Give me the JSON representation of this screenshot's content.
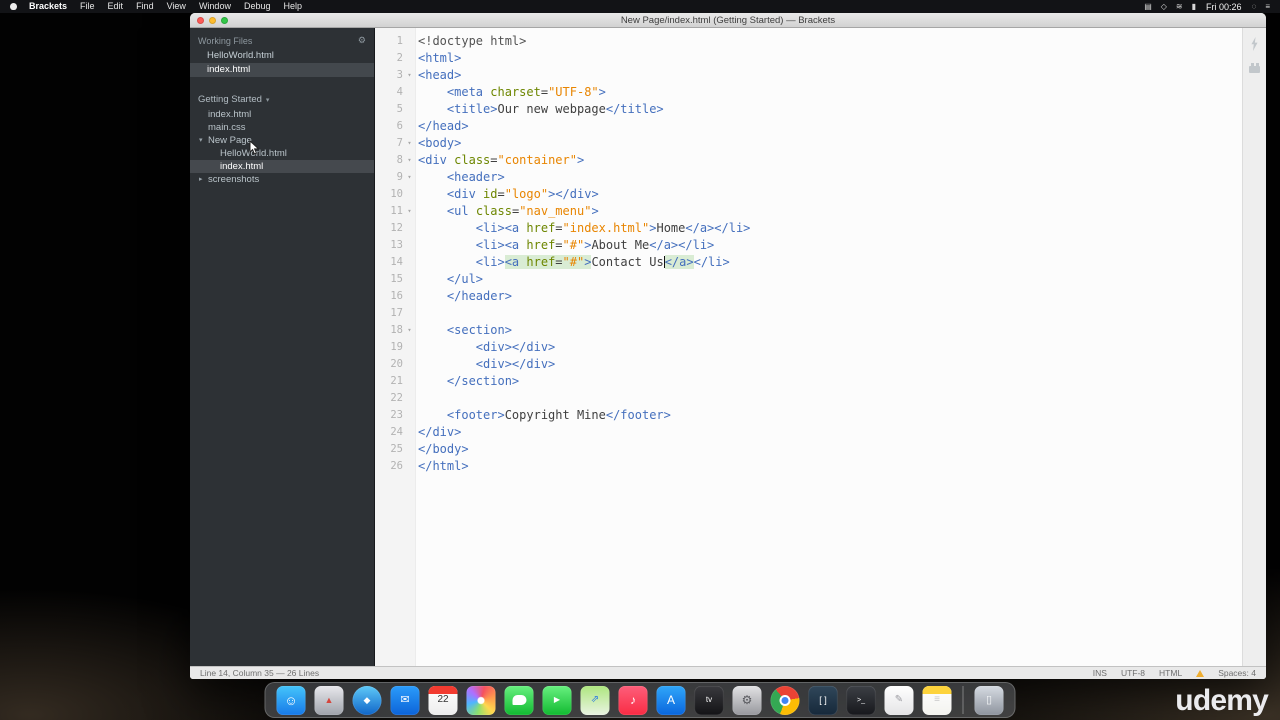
{
  "menu_bar": {
    "items": [
      "Brackets",
      "File",
      "Edit",
      "Find",
      "View",
      "Window",
      "Debug",
      "Help"
    ],
    "status_icons": [
      {
        "name": "display",
        "glyph": "▤"
      },
      {
        "name": "bluetooth",
        "glyph": "◇"
      },
      {
        "name": "wifi",
        "glyph": "≋"
      },
      {
        "name": "battery",
        "glyph": "▮"
      }
    ],
    "clock": "Fri 00:26",
    "after_icons": [
      {
        "name": "spotlight",
        "glyph": "◌"
      },
      {
        "name": "notification-center",
        "glyph": "≡"
      }
    ]
  },
  "window": {
    "title": "New Page/index.html (Getting Started) — Brackets"
  },
  "sidebar": {
    "working_files": {
      "header": "Working Files",
      "files": [
        {
          "name": "HelloWorld.html",
          "active": false
        },
        {
          "name": "index.html",
          "active": true
        }
      ]
    },
    "project": {
      "name": "Getting Started",
      "tree": [
        {
          "name": "index.html",
          "type": "file",
          "depth": 0
        },
        {
          "name": "main.css",
          "type": "file",
          "depth": 0
        },
        {
          "name": "New Page",
          "type": "folder-open",
          "depth": 0
        },
        {
          "name": "HelloWorld.html",
          "type": "file",
          "depth": 1
        },
        {
          "name": "index.html",
          "type": "file",
          "depth": 1,
          "selected": true
        },
        {
          "name": "screenshots",
          "type": "folder",
          "depth": 0
        }
      ]
    }
  },
  "editor": {
    "syntax_colors": {
      "tag": "#446fbd",
      "attribute": "#6d8600",
      "string": "#e88501",
      "meta": "#535353",
      "text": "#404040",
      "tag_match_highlight": "#d9ecd4"
    },
    "lines": [
      {
        "n": 1,
        "tokens": [
          [
            "meta",
            "<!doctype html>"
          ]
        ]
      },
      {
        "n": 2,
        "tokens": [
          [
            "tag",
            "<html>"
          ]
        ]
      },
      {
        "n": 3,
        "fold": true,
        "tokens": [
          [
            "tag",
            "<head>"
          ]
        ]
      },
      {
        "n": 4,
        "tokens": [
          [
            "plain",
            "    "
          ],
          [
            "tag",
            "<meta"
          ],
          [
            "plain",
            " "
          ],
          [
            "attr",
            "charset"
          ],
          [
            "plain",
            "="
          ],
          [
            "str",
            "\"UTF-8\""
          ],
          [
            "tag",
            ">"
          ]
        ]
      },
      {
        "n": 5,
        "tokens": [
          [
            "plain",
            "    "
          ],
          [
            "tag",
            "<title>"
          ],
          [
            "plain",
            "Our new webpage"
          ],
          [
            "tag",
            "</title>"
          ]
        ]
      },
      {
        "n": 6,
        "tokens": [
          [
            "tag",
            "</head>"
          ]
        ]
      },
      {
        "n": 7,
        "fold": true,
        "tokens": [
          [
            "tag",
            "<body>"
          ]
        ]
      },
      {
        "n": 8,
        "fold": true,
        "tokens": [
          [
            "tag",
            "<div"
          ],
          [
            "plain",
            " "
          ],
          [
            "attr",
            "class"
          ],
          [
            "plain",
            "="
          ],
          [
            "str",
            "\"container\""
          ],
          [
            "tag",
            ">"
          ]
        ]
      },
      {
        "n": 9,
        "fold": true,
        "tokens": [
          [
            "plain",
            "    "
          ],
          [
            "tag",
            "<header>"
          ]
        ]
      },
      {
        "n": 10,
        "tokens": [
          [
            "plain",
            "    "
          ],
          [
            "tag",
            "<div"
          ],
          [
            "plain",
            " "
          ],
          [
            "attr",
            "id"
          ],
          [
            "plain",
            "="
          ],
          [
            "str",
            "\"logo\""
          ],
          [
            "tag",
            "></div>"
          ]
        ]
      },
      {
        "n": 11,
        "fold": true,
        "tokens": [
          [
            "plain",
            "    "
          ],
          [
            "tag",
            "<ul"
          ],
          [
            "plain",
            " "
          ],
          [
            "attr",
            "class"
          ],
          [
            "plain",
            "="
          ],
          [
            "str",
            "\"nav_menu\""
          ],
          [
            "tag",
            ">"
          ]
        ]
      },
      {
        "n": 12,
        "tokens": [
          [
            "plain",
            "        "
          ],
          [
            "tag",
            "<li><a"
          ],
          [
            "plain",
            " "
          ],
          [
            "attr",
            "href"
          ],
          [
            "plain",
            "="
          ],
          [
            "str",
            "\"index.html\""
          ],
          [
            "tag",
            ">"
          ],
          [
            "plain",
            "Home"
          ],
          [
            "tag",
            "</a></li>"
          ]
        ]
      },
      {
        "n": 13,
        "tokens": [
          [
            "plain",
            "        "
          ],
          [
            "tag",
            "<li><a"
          ],
          [
            "plain",
            " "
          ],
          [
            "attr",
            "href"
          ],
          [
            "plain",
            "="
          ],
          [
            "str",
            "\"#\""
          ],
          [
            "tag",
            ">"
          ],
          [
            "plain",
            "About Me"
          ],
          [
            "tag",
            "</a></li>"
          ]
        ]
      },
      {
        "n": 14,
        "tokens": [
          [
            "plain",
            "        "
          ],
          [
            "tag",
            "<li>"
          ],
          [
            "tag",
            "<a",
            1
          ],
          [
            "plain",
            " ",
            1
          ],
          [
            "attr",
            "href",
            1
          ],
          [
            "plain",
            "=",
            1
          ],
          [
            "str",
            "\"#\"",
            1
          ],
          [
            "tag",
            ">",
            1
          ],
          [
            "plain",
            "Contact Us"
          ],
          [
            "caret",
            ""
          ],
          [
            "tag",
            "</a>",
            1
          ],
          [
            "tag",
            "</li>"
          ]
        ]
      },
      {
        "n": 15,
        "tokens": [
          [
            "plain",
            "    "
          ],
          [
            "tag",
            "</ul>"
          ]
        ]
      },
      {
        "n": 16,
        "tokens": [
          [
            "plain",
            "    "
          ],
          [
            "tag",
            "</header>"
          ]
        ]
      },
      {
        "n": 17,
        "tokens": []
      },
      {
        "n": 18,
        "fold": true,
        "tokens": [
          [
            "plain",
            "    "
          ],
          [
            "tag",
            "<section>"
          ]
        ]
      },
      {
        "n": 19,
        "tokens": [
          [
            "plain",
            "        "
          ],
          [
            "tag",
            "<div></div>"
          ]
        ]
      },
      {
        "n": 20,
        "tokens": [
          [
            "plain",
            "        "
          ],
          [
            "tag",
            "<div></div>"
          ]
        ]
      },
      {
        "n": 21,
        "tokens": [
          [
            "plain",
            "    "
          ],
          [
            "tag",
            "</section>"
          ]
        ]
      },
      {
        "n": 22,
        "tokens": []
      },
      {
        "n": 23,
        "tokens": [
          [
            "plain",
            "    "
          ],
          [
            "tag",
            "<footer>"
          ],
          [
            "plain",
            "Copyright Mine"
          ],
          [
            "tag",
            "</footer>"
          ]
        ]
      },
      {
        "n": 24,
        "tokens": [
          [
            "tag",
            "</div>"
          ]
        ]
      },
      {
        "n": 25,
        "tokens": [
          [
            "tag",
            "</body>"
          ]
        ]
      },
      {
        "n": 26,
        "tokens": [
          [
            "tag",
            "</html>"
          ]
        ]
      }
    ],
    "status_bar": {
      "left": "Line 14, Column 35 — 26 Lines",
      "right": [
        {
          "name": "insert-mode",
          "label": "INS"
        },
        {
          "name": "encoding",
          "label": "UTF-8"
        },
        {
          "name": "language",
          "label": "HTML"
        },
        {
          "name": "warning",
          "icon": true
        },
        {
          "name": "indent",
          "label": "Spaces: 4"
        }
      ]
    }
  },
  "dock": {
    "items": [
      {
        "name": "finder",
        "bg": [
          "#45c5fb",
          "#1779e8"
        ],
        "glyph": "☺",
        "fg": "#ffffff",
        "gs": 13
      },
      {
        "name": "launchpad",
        "bg": [
          "#e8e8ec",
          "#9fa3ab"
        ],
        "glyph": "▲",
        "fg": "#d6453c",
        "gs": 9
      },
      {
        "name": "safari",
        "round": true,
        "bg": [
          "#5ec9f8",
          "#1065c8"
        ],
        "glyph": "◆",
        "fg": "#ffffff",
        "gs": 9
      },
      {
        "name": "mail",
        "bg": [
          "#2b9cfb",
          "#0c63d8"
        ],
        "glyph": "✉",
        "fg": "#ffffff",
        "gs": 11
      },
      {
        "name": "calendar",
        "bg": [
          "#ffffff",
          "#ededed"
        ],
        "strip": "#f23b30",
        "glyph": "22",
        "fg": "#333333",
        "gs": 10
      },
      {
        "name": "photos",
        "cls": "photos"
      },
      {
        "name": "messages",
        "bg": [
          "#67f07f",
          "#12ba31"
        ],
        "shape": "bubble"
      },
      {
        "name": "facetime",
        "bg": [
          "#67f07f",
          "#12ba31"
        ],
        "glyph": "▶",
        "fg": "#ffffff",
        "gs": 8
      },
      {
        "name": "maps",
        "bg": [
          "#aee67f",
          "#e9f3e2"
        ],
        "glyph": "⇗",
        "fg": "#2f7ce0",
        "gs": 10
      },
      {
        "name": "music",
        "bg": [
          "#fd5e7a",
          "#f92c44"
        ],
        "glyph": "♪",
        "fg": "#ffffff",
        "gs": 12
      },
      {
        "name": "app-store",
        "bg": [
          "#30a6f9",
          "#0a66dd"
        ],
        "glyph": "A",
        "fg": "#ffffff",
        "gs": 12
      },
      {
        "name": "apple-tv",
        "bg": [
          "#3a3a3e",
          "#131316"
        ],
        "glyph": "tv",
        "fg": "#ffffff",
        "gs": 8
      },
      {
        "name": "system-preferences",
        "bg": [
          "#e2e2e4",
          "#97989d"
        ],
        "glyph": "⚙",
        "fg": "#56575c",
        "gs": 12
      },
      {
        "name": "chrome",
        "round": true,
        "cls": "chrome",
        "shape": "chrome-dot"
      },
      {
        "name": "brackets",
        "bg": [
          "#30475a",
          "#16283a"
        ],
        "glyph": "[ ]",
        "fg": "#ffffff",
        "gs": 9
      },
      {
        "name": "terminal",
        "bg": [
          "#3c3f45",
          "#17181c"
        ],
        "glyph": ">_",
        "fg": "#ffffff",
        "gs": 7
      },
      {
        "name": "textedit",
        "bg": [
          "#ffffff",
          "#e4e4e6"
        ],
        "glyph": "✎",
        "fg": "#9a9aa0",
        "gs": 10
      },
      {
        "name": "notes",
        "bg": [
          "#ffffff",
          "#f3f3ef"
        ],
        "strip": "#fdd33c",
        "glyph": "≡",
        "fg": "#c9c9c9",
        "gs": 10
      },
      {
        "divider": true
      },
      {
        "name": "trash",
        "bg": [
          "#d6dbe2",
          "#8e949e"
        ],
        "glyph": "▯",
        "fg": "#f4f6f8",
        "gs": 11
      }
    ]
  },
  "watermark": "udemy"
}
